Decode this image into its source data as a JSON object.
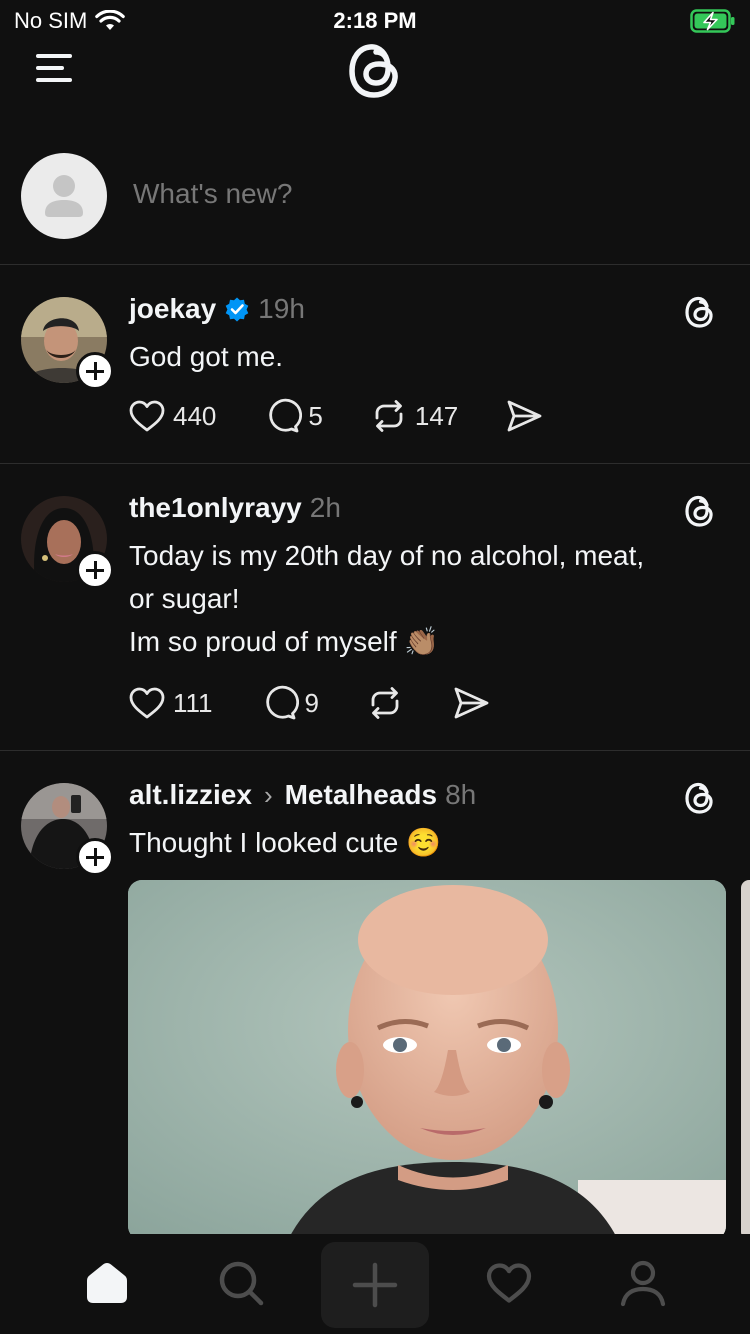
{
  "status_bar": {
    "carrier": "No SIM",
    "time": "2:18 PM"
  },
  "composer": {
    "placeholder": "What's new?"
  },
  "posts": [
    {
      "username": "joekay",
      "verified": true,
      "time": "19h",
      "text_lines": [
        "God got me."
      ],
      "likes": "440",
      "replies": "5",
      "reposts": "147"
    },
    {
      "username": "the1onlyrayy",
      "verified": false,
      "time": "2h",
      "text_lines": [
        "Today is my 20th day of no alcohol, meat,",
        "or sugar!",
        "Im so proud of myself 👏🏽"
      ],
      "likes": "111",
      "replies": "9",
      "reposts": ""
    },
    {
      "username": "alt.lizziex",
      "community": "Metalheads",
      "verified": false,
      "time": "8h",
      "text_lines": [
        "Thought I looked cute ☺️"
      ],
      "has_image": true
    }
  ],
  "tabbar": {
    "items": [
      "home-icon",
      "search-icon",
      "compose-plus-icon",
      "heart-icon",
      "profile-icon"
    ],
    "active": "home-icon"
  },
  "colors": {
    "background": "#101010",
    "text": "#f3f5f7",
    "muted": "#777777",
    "divider": "#2d2d2d",
    "verified": "#0095f6",
    "battery": "#34c759"
  }
}
